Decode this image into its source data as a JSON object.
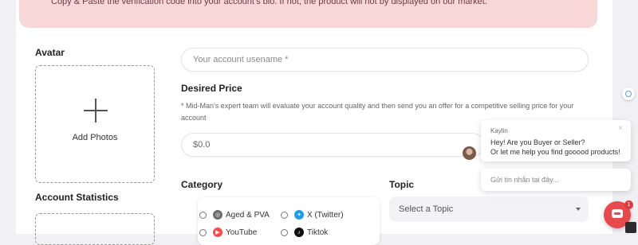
{
  "alert": {
    "text": "Copy & Paste the verification code into your account's bio. If not, the product will not by displayed on our market."
  },
  "avatar": {
    "label": "Avatar",
    "add_photos": "Add Photos"
  },
  "account_statistics": {
    "label": "Account Statistics"
  },
  "username": {
    "placeholder": "Your account usename *"
  },
  "price": {
    "label": "Desired Price",
    "note": "* Mid-Man's expert team will evaluate your account quality and then send you an offer for a competitive selling price for your account",
    "value": "$0.0"
  },
  "category": {
    "label": "Category",
    "options": [
      {
        "label": "Aged & PVA",
        "icon": "aged-pva-icon",
        "color": "#6b6b6b"
      },
      {
        "label": "X (Twitter)",
        "icon": "twitter-icon",
        "color": "#1d9bf0"
      },
      {
        "label": "YouTube",
        "icon": "youtube-icon",
        "color": "#ff4a4a"
      },
      {
        "label": "Tiktok",
        "icon": "tiktok-icon",
        "color": "#111111"
      }
    ]
  },
  "topic": {
    "label": "Topic",
    "selected": "Select a Topic"
  },
  "chat": {
    "agent_name": "Kaylin",
    "line1": "Hey! Are you Buyer or Seller?",
    "line2": "Or let me help you find gooood products!",
    "input_placeholder": "Gửi tin nhắn tại đây...",
    "badge_count": "1"
  },
  "colors": {
    "alert_bg": "#f8d7d9",
    "launcher": "#e8494d",
    "page_bg": "#f1f1f3"
  }
}
